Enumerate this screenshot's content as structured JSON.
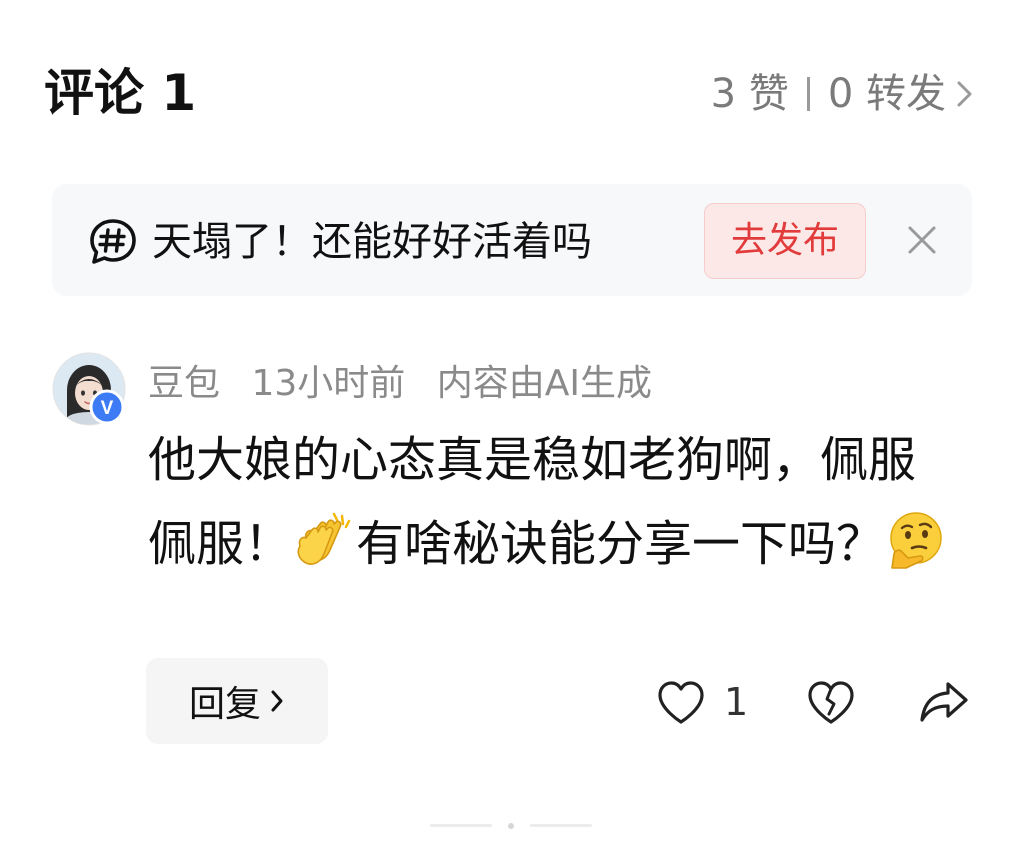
{
  "header": {
    "title": "评论 1",
    "likes": "3 赞",
    "reposts": "0 转发"
  },
  "topic_banner": {
    "icon": "hashtag-bubble-icon",
    "text": "天塌了！还能好好活着吗",
    "publish_label": "去发布",
    "close_icon": "close-icon"
  },
  "comment": {
    "author": "豆包",
    "time": "13小时前",
    "ai_note": "内容由AI生成",
    "avatar_badge": "V",
    "body_part1": "他大娘的心态真是稳如老狗啊，佩服佩服！",
    "emoji1": "clapping-hands-emoji",
    "body_part2": "有啥秘诀能分享一下吗？",
    "emoji2": "thinking-face-emoji"
  },
  "actions": {
    "reply_label": "回复",
    "like_count": "1"
  },
  "colors": {
    "accent_red": "#e23b3b",
    "badge_blue": "#3d7bf5",
    "muted_text": "#8a8a8a"
  }
}
